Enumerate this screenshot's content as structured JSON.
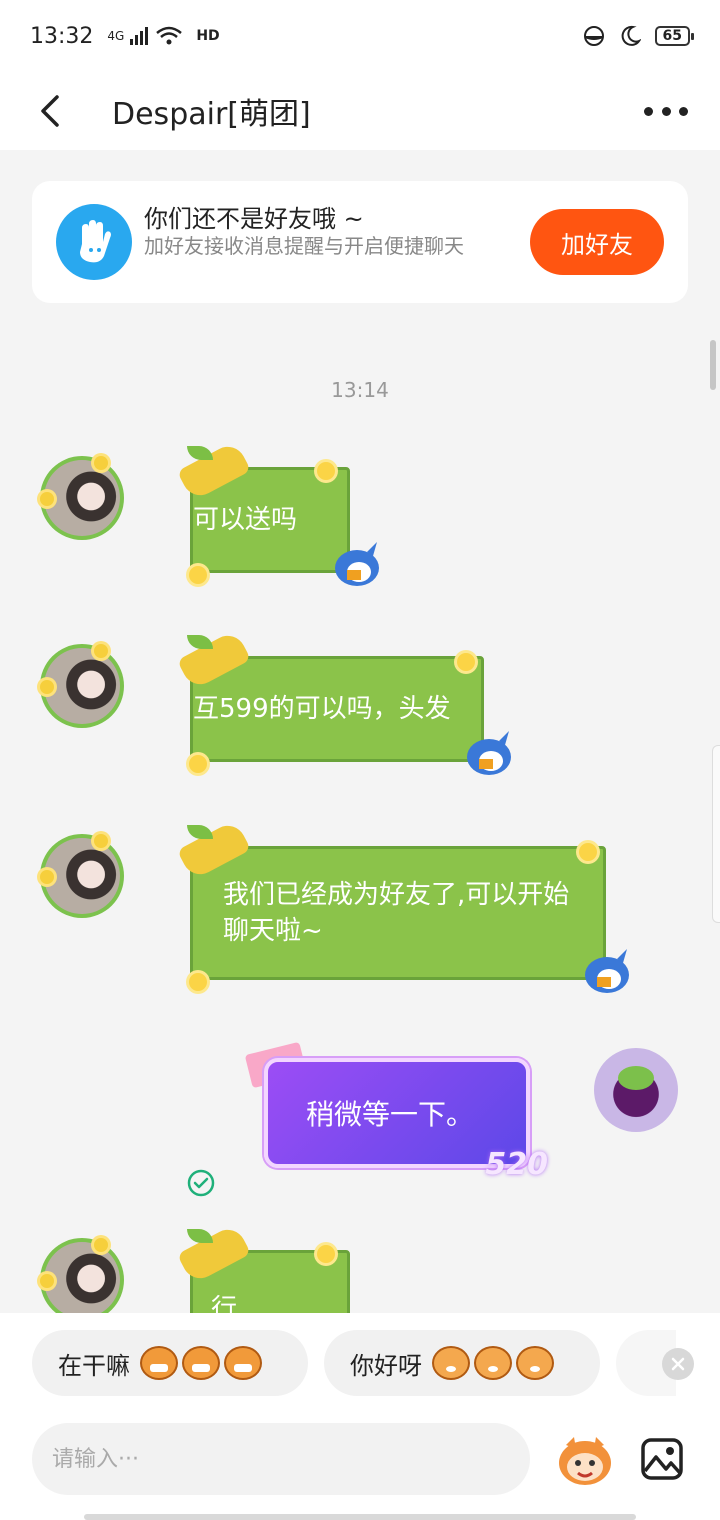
{
  "status_bar": {
    "time": "13:32",
    "network": "4G",
    "hd_label": "HD",
    "battery": "65"
  },
  "header": {
    "title": "Despair[萌团]"
  },
  "friend_card": {
    "title": "你们还不是好友哦 ~",
    "subtitle": "加好友接收消息提醒与开启便捷聊天",
    "button": "加好友"
  },
  "timestamp": "13:14",
  "messages": [
    {
      "side": "left",
      "text": "可以送吗"
    },
    {
      "side": "left",
      "text": "互599的可以吗，头发"
    },
    {
      "side": "left",
      "text": "我们已经成为好友了,可以开始聊天啦~"
    },
    {
      "side": "right",
      "text": "稍微等一下。",
      "tag": "520"
    },
    {
      "side": "left",
      "text": "行"
    }
  ],
  "quick_replies": [
    {
      "text": "在干嘛"
    },
    {
      "text": "你好呀"
    }
  ],
  "input": {
    "placeholder": "请输入···"
  },
  "colors": {
    "accent": "#ff5511",
    "bubble_green": "#8bc34a",
    "bubble_purple": "#7a4af0",
    "avatar_blue": "#29a8ef"
  }
}
